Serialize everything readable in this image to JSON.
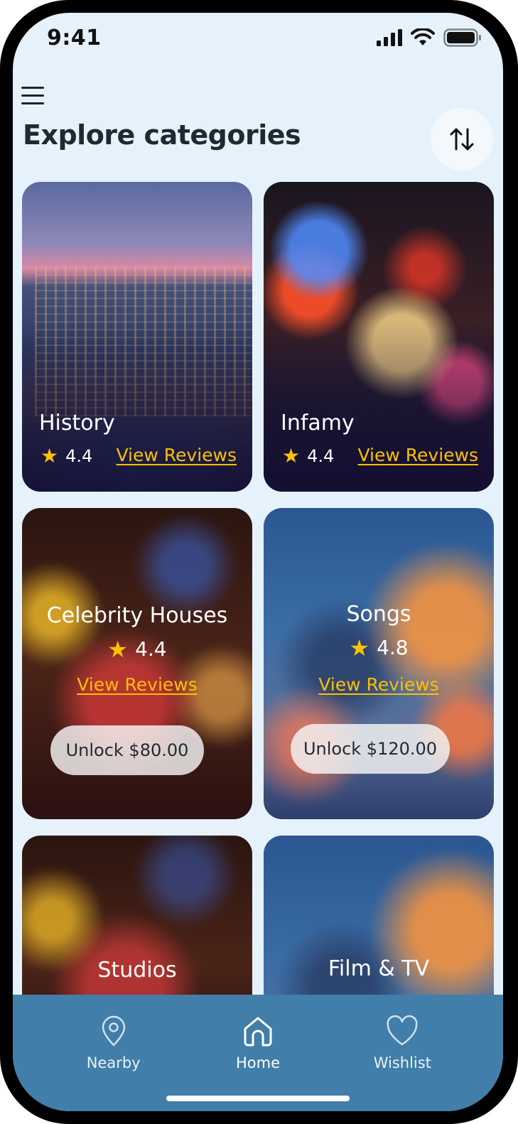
{
  "status_bar": {
    "time": "9:41"
  },
  "header": {
    "title": "Explore categories"
  },
  "categories": [
    {
      "title": "History",
      "rating": "4.4",
      "reviews_label": "View Reviews"
    },
    {
      "title": "Infamy",
      "rating": "4.4",
      "reviews_label": "View Reviews"
    },
    {
      "title": "Celebrity Houses",
      "rating": "4.4",
      "reviews_label": "View Reviews",
      "unlock_label": "Unlock $80.00"
    },
    {
      "title": "Songs",
      "rating": "4.8",
      "reviews_label": "View Reviews",
      "unlock_label": "Unlock $120.00"
    },
    {
      "title": "Studios"
    },
    {
      "title": "Film & TV"
    }
  ],
  "bottom_nav": [
    {
      "label": "Nearby",
      "icon": "location-pin-icon"
    },
    {
      "label": "Home",
      "icon": "home-icon"
    },
    {
      "label": "Wishlist",
      "icon": "heart-icon"
    }
  ],
  "colors": {
    "background": "#e6f2fb",
    "nav_bar": "#417ea9",
    "link": "#ffbf00",
    "star": "#ffc107"
  }
}
